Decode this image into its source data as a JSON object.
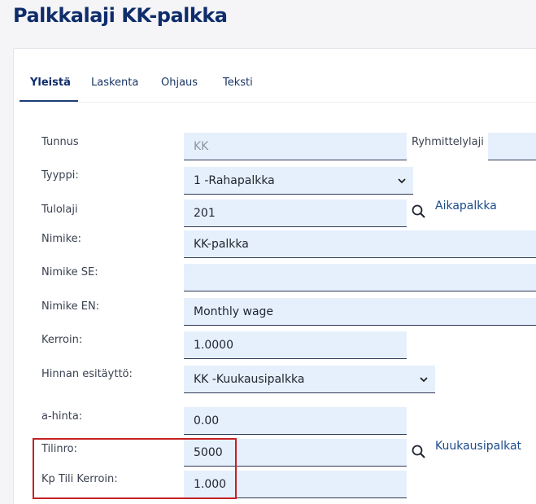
{
  "page": {
    "title": "Palkkalaji KK-palkka"
  },
  "tabs": [
    {
      "label": "Yleistä",
      "active": true
    },
    {
      "label": "Laskenta",
      "active": false
    },
    {
      "label": "Ohjaus",
      "active": false
    },
    {
      "label": "Teksti",
      "active": false
    }
  ],
  "form": {
    "tunnus": {
      "label": "Tunnus",
      "value": "KK"
    },
    "ryhmittelylaji": {
      "label": "Ryhmittelylaji",
      "value": ""
    },
    "tyyppi": {
      "label": "Tyyppi:",
      "value": "1 -Rahapalkka"
    },
    "tulolaji": {
      "label": "Tulolaji",
      "value": "201",
      "link": "Aikapalkka"
    },
    "nimike": {
      "label": "Nimike:",
      "value": "KK-palkka"
    },
    "nimike_se": {
      "label": "Nimike SE:",
      "value": ""
    },
    "nimike_en": {
      "label": "Nimike EN:",
      "value": "Monthly wage"
    },
    "kerroin": {
      "label": "Kerroin:",
      "value": "1.0000"
    },
    "hinnan_esitaytto": {
      "label": "Hinnan esitäyttö:",
      "value": "KK -Kuukausipalkka"
    },
    "a_hinta": {
      "label": "a-hinta:",
      "value": "0.00"
    },
    "tilinro": {
      "label": "Tilinro:",
      "value": "5000",
      "link": "Kuukausipalkat"
    },
    "kp_tili_kerroin": {
      "label": "Kp Tili Kerroin:",
      "value": "1.000"
    }
  },
  "colors": {
    "accent": "#0f2d6b",
    "field_bg": "#e6f0fc",
    "highlight": "#c42121"
  },
  "icons": {
    "search": "search-icon",
    "dropdown": "chevron-down-icon"
  }
}
